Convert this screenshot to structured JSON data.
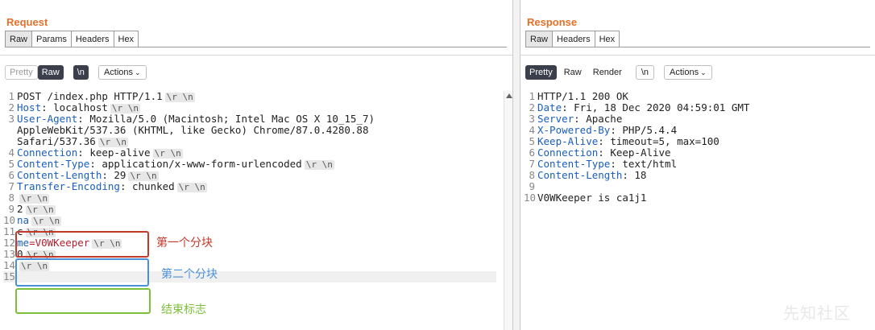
{
  "request": {
    "title": "Request",
    "tabs": [
      "Raw",
      "Params",
      "Headers",
      "Hex"
    ],
    "toolbar": {
      "pretty": "Pretty",
      "raw": "Raw",
      "newline": "\\n",
      "actions": "Actions"
    },
    "lines": [
      {
        "n": "1",
        "key": "",
        "val": "POST /index.php HTTP/1.1",
        "crlf": [
          "\\r \\n"
        ]
      },
      {
        "n": "2",
        "key": "Host",
        "val": ": localhost",
        "crlf": [
          "\\r \\n"
        ]
      },
      {
        "n": "3",
        "key": "User-Agent",
        "val": ": Mozilla/5.0 (Macintosh; Intel Mac OS X 10_15_7)"
      },
      {
        "n": "",
        "key": "",
        "val": "AppleWebKit/537.36 (KHTML, like Gecko) Chrome/87.0.4280.88"
      },
      {
        "n": "",
        "key": "",
        "val": "Safari/537.36",
        "crlf": [
          "\\r \\n"
        ]
      },
      {
        "n": "4",
        "key": "Connection",
        "val": ": keep-alive",
        "crlf": [
          "\\r \\n"
        ]
      },
      {
        "n": "5",
        "key": "Content-Type",
        "val": ": application/x-www-form-urlencoded",
        "crlf": [
          "\\r \\n"
        ]
      },
      {
        "n": "6",
        "key": "Content-Length",
        "val": ": 29",
        "crlf": [
          "\\r \\n"
        ]
      },
      {
        "n": "7",
        "key": "Transfer-Encoding",
        "val": ": chunked",
        "crlf": [
          "\\r \\n"
        ]
      },
      {
        "n": "8",
        "key": "",
        "val": "",
        "crlf": [
          "\\r \\n"
        ]
      },
      {
        "n": "9",
        "key": "",
        "val": "2",
        "crlf": [
          "\\r \\n"
        ]
      },
      {
        "n": "10",
        "key": "na",
        "val": "",
        "crlf": [
          "\\r \\n"
        ]
      },
      {
        "n": "11",
        "key": "",
        "val": "c",
        "crlf": [
          "\\r \\n"
        ]
      },
      {
        "n": "12",
        "key": "me",
        "val": "=V0WKeeper",
        "red": true,
        "crlf": [
          "\\r \\n"
        ]
      },
      {
        "n": "13",
        "key": "",
        "val": "0",
        "crlf": [
          "\\r \\n"
        ]
      },
      {
        "n": "14",
        "key": "",
        "val": "",
        "crlf": [
          "\\r \\n"
        ]
      },
      {
        "n": "15",
        "key": "",
        "val": ""
      }
    ],
    "annotations": {
      "first_chunk": "第一个分块",
      "second_chunk": "第二个分块",
      "end_marker": "结束标志"
    },
    "annotation_colors": {
      "first": "#c0392b",
      "second": "#4a90d9",
      "end": "#7dbf3a"
    }
  },
  "response": {
    "title": "Response",
    "tabs": [
      "Raw",
      "Headers",
      "Hex"
    ],
    "toolbar": {
      "pretty": "Pretty",
      "raw": "Raw",
      "render": "Render",
      "newline": "\\n",
      "actions": "Actions"
    },
    "lines": [
      {
        "n": "1",
        "key": "",
        "val": "HTTP/1.1 200 OK"
      },
      {
        "n": "2",
        "key": "Date",
        "val": ": Fri, 18 Dec 2020 04:59:01 GMT"
      },
      {
        "n": "3",
        "key": "Server",
        "val": ": Apache"
      },
      {
        "n": "4",
        "key": "X-Powered-By",
        "val": ": PHP/5.4.4"
      },
      {
        "n": "5",
        "key": "Keep-Alive",
        "val": ": timeout=5, max=100"
      },
      {
        "n": "6",
        "key": "Connection",
        "val": ": Keep-Alive"
      },
      {
        "n": "7",
        "key": "Content-Type",
        "val": ": text/html"
      },
      {
        "n": "8",
        "key": "Content-Length",
        "val": ": 18"
      },
      {
        "n": "9",
        "key": "",
        "val": ""
      },
      {
        "n": "10",
        "key": "",
        "val": "V0WKeeper is ca1j1"
      }
    ]
  },
  "watermark": "先知社区",
  "colors": {
    "accent": "#e4702a",
    "header_key": "#1a5ebd",
    "dark_button": "#3a3f4b"
  }
}
